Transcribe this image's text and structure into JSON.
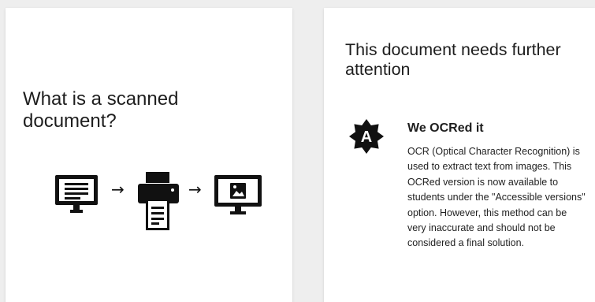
{
  "left_card": {
    "title": "What is a scanned document?",
    "diagram": {
      "icons": [
        "monitor-document-icon",
        "printer-icon",
        "monitor-image-icon"
      ],
      "arrow_glyph": "→"
    }
  },
  "right_card": {
    "title": "This document needs further attention",
    "badge": {
      "letter": "A",
      "icon": "starburst-badge-icon"
    },
    "section_title": "We OCRed it",
    "description": "OCR (Optical Character Recognition) is used to extract text from images. This OCRed version is now available to students under the \"Accessible versions\" option. However, this method can be very inaccurate and should not be considered a final solution."
  },
  "colors": {
    "background": "#eeeeee",
    "card": "#ffffff",
    "icon": "#111111",
    "text": "#1e1e1e"
  }
}
